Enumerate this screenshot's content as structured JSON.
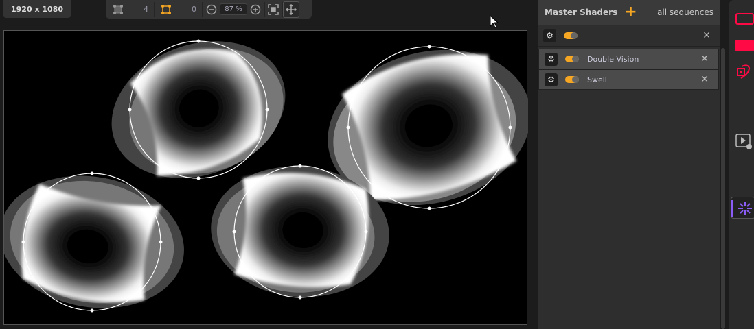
{
  "resolution": "1920 x 1080",
  "toolbar": {
    "shape_count": "4",
    "selected_count": "0",
    "zoom": "87 %"
  },
  "shaders": {
    "title": "Master Shaders",
    "scope": "all sequences",
    "items": [
      {
        "label": "",
        "enabled": true
      },
      {
        "label": "Double Vision",
        "enabled": true
      },
      {
        "label": "Swell",
        "enabled": true
      }
    ]
  },
  "colors": {
    "accent": "#f5a623",
    "red": "#ff0a45",
    "purple": "#8b5cf6"
  }
}
